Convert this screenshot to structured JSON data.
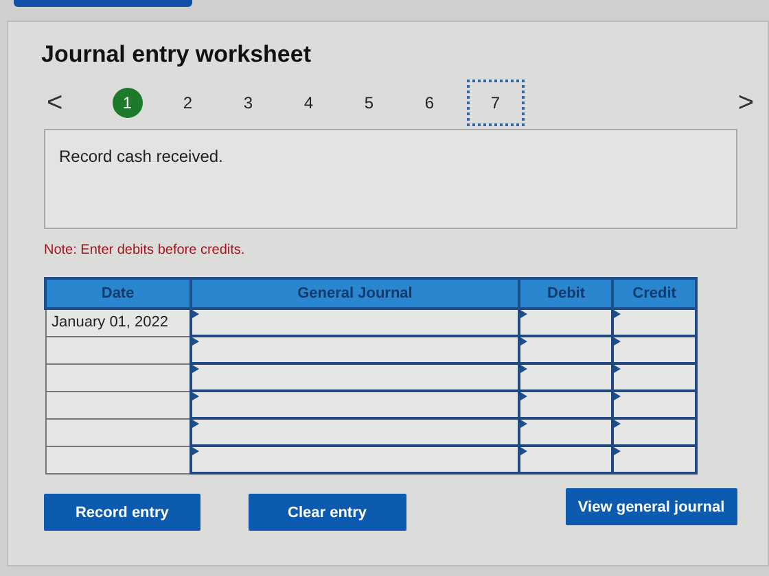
{
  "title": "Journal entry worksheet",
  "pager": {
    "prev": "<",
    "next": ">",
    "steps": [
      {
        "label": "1",
        "selected": true,
        "focused": false
      },
      {
        "label": "2",
        "selected": false,
        "focused": false
      },
      {
        "label": "3",
        "selected": false,
        "focused": false
      },
      {
        "label": "4",
        "selected": false,
        "focused": false
      },
      {
        "label": "5",
        "selected": false,
        "focused": false
      },
      {
        "label": "6",
        "selected": false,
        "focused": false
      },
      {
        "label": "7",
        "selected": false,
        "focused": true
      }
    ]
  },
  "instruction": "Record cash received.",
  "note": "Note: Enter debits before credits.",
  "table": {
    "columns": [
      "Date",
      "General Journal",
      "Debit",
      "Credit"
    ],
    "rows": [
      {
        "date": "January 01, 2022"
      },
      {},
      {},
      {},
      {},
      {}
    ]
  },
  "buttons": [
    "Record entry",
    "Clear entry",
    "View general journal"
  ]
}
